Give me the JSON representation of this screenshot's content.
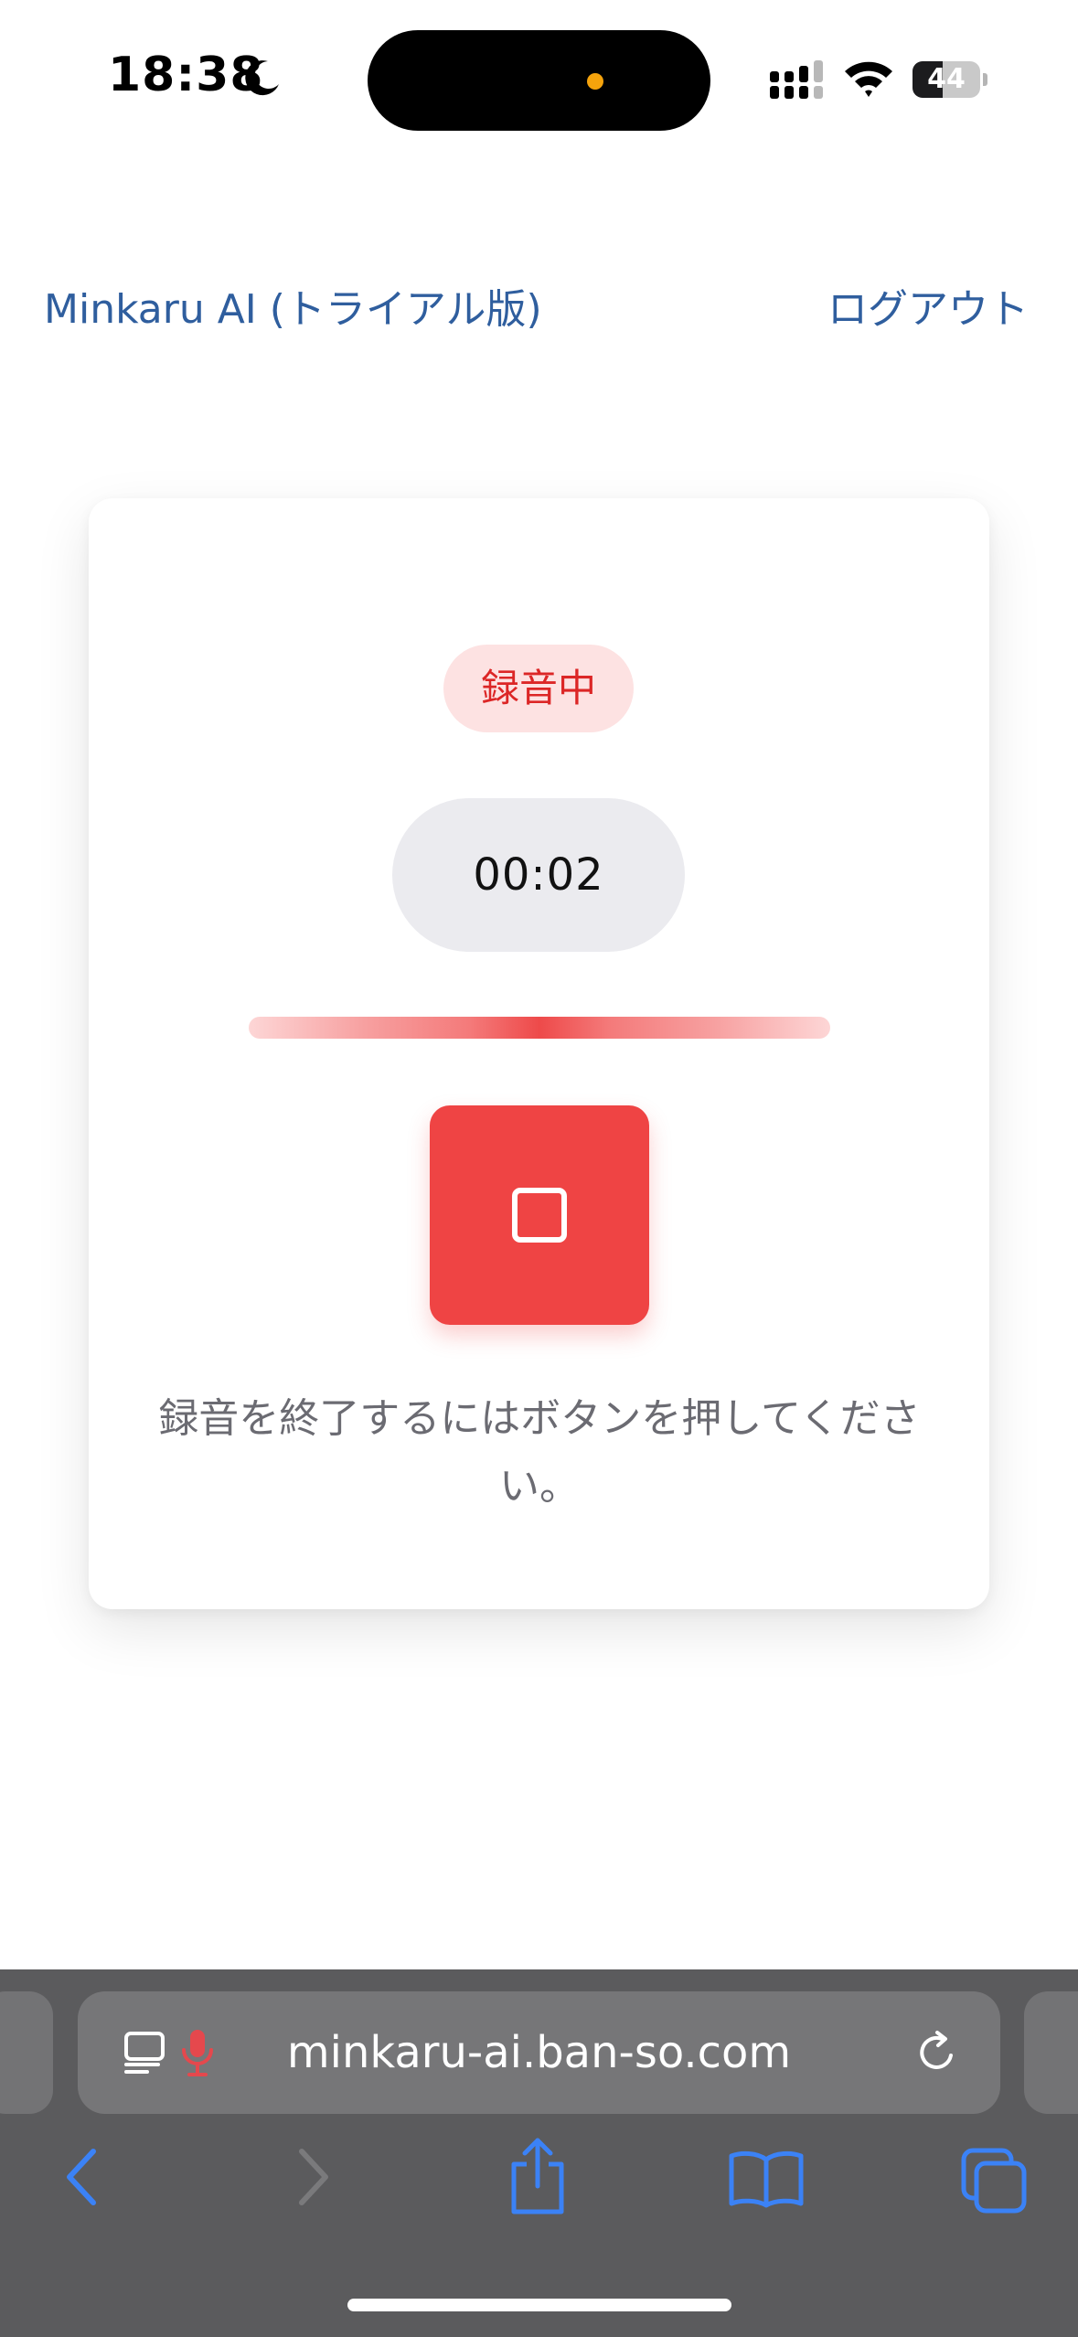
{
  "status_bar": {
    "time": "18:38",
    "battery_level": "44",
    "battery_fraction": 0.44
  },
  "header": {
    "app_title": "Minkaru AI (トライアル版)",
    "logout_label": "ログアウト"
  },
  "recorder": {
    "status_badge": "録音中",
    "timer": "00:02",
    "instruction": "録音を終了するにはボタンを押してください。"
  },
  "browser": {
    "url": "minkaru-ai.ban-so.com"
  },
  "colors": {
    "accent_blue": "#2f5e9e",
    "record_red": "#ef4444",
    "badge_bg": "#fde2e2",
    "toolbar_blue": "#3b82f6"
  },
  "icons": {
    "status": [
      "moon-icon",
      "cellular-signal-icon",
      "wifi-icon",
      "battery-icon"
    ],
    "address_bar": [
      "reader-icon",
      "microphone-icon",
      "reload-icon"
    ],
    "toolbar": [
      "back-icon",
      "forward-icon",
      "share-icon",
      "bookmarks-icon",
      "tabs-icon"
    ]
  }
}
